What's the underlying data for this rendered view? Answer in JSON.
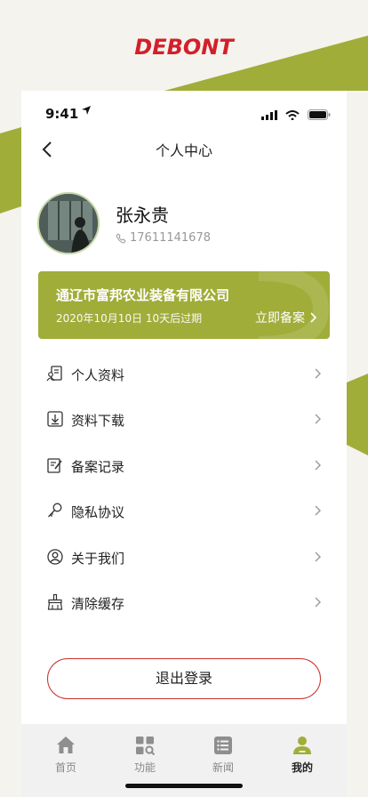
{
  "brand": {
    "logo_text": "DEBONT",
    "logo_color": "#d2202a",
    "accent": "#a0ad39"
  },
  "status_bar": {
    "time": "9:41"
  },
  "nav": {
    "title": "个人中心"
  },
  "profile": {
    "name": "张永贵",
    "phone": "17611141678"
  },
  "company": {
    "name": "通辽市富邦农业装备有限公司",
    "date_info": "2020年10月10日  10天后过期",
    "action_label": "立即备案"
  },
  "menu": [
    {
      "label": "个人资料",
      "icon": "profile-card-icon"
    },
    {
      "label": "资料下载",
      "icon": "download-icon"
    },
    {
      "label": "备案记录",
      "icon": "record-edit-icon"
    },
    {
      "label": "隐私协议",
      "icon": "key-icon"
    },
    {
      "label": "关于我们",
      "icon": "user-circle-icon"
    },
    {
      "label": "清除缓存",
      "icon": "broom-icon"
    }
  ],
  "logout": {
    "label": "退出登录",
    "border_color": "#c9322e"
  },
  "tabbar": [
    {
      "label": "首页",
      "icon": "home-icon",
      "active": false
    },
    {
      "label": "功能",
      "icon": "grid-search-icon",
      "active": false
    },
    {
      "label": "新闻",
      "icon": "news-list-icon",
      "active": false
    },
    {
      "label": "我的",
      "icon": "person-icon",
      "active": true
    }
  ]
}
